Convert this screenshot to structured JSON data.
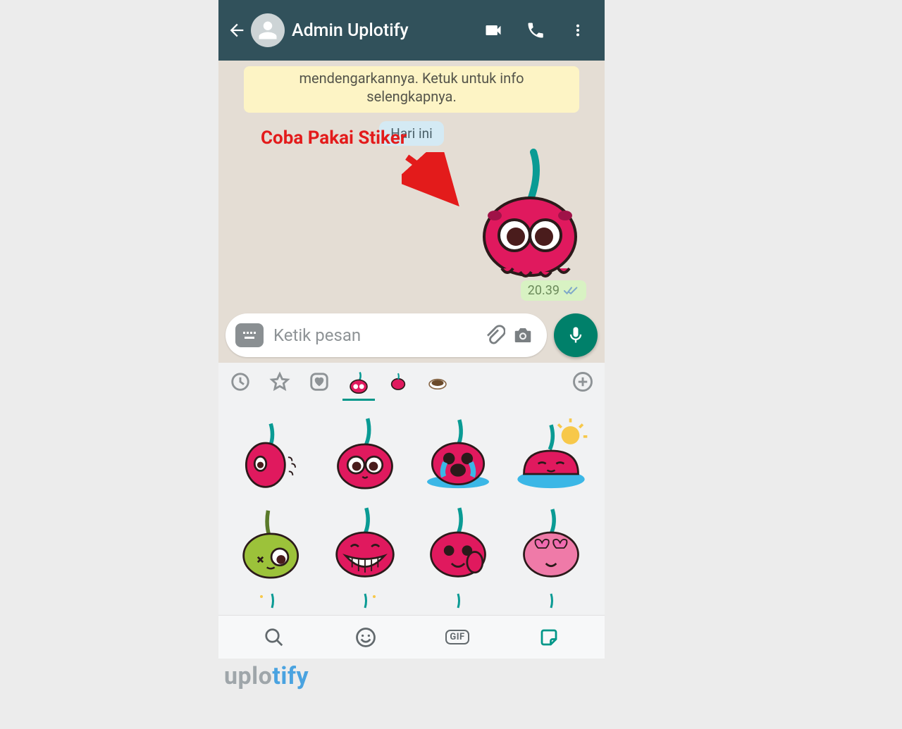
{
  "header": {
    "contact_name": "Admin Uplotify"
  },
  "chat": {
    "info_banner": "mendengarkannya. Ketuk untuk info selengkapnya.",
    "date_chip": "Hari ini",
    "annotation_label": "Coba Pakai Stiker",
    "message_time": "20.39"
  },
  "input": {
    "placeholder": "Ketik pesan"
  },
  "bottom_tabs": {
    "gif_label": "GIF"
  },
  "watermark": {
    "prefix": "uplo",
    "suffix": "tify"
  }
}
